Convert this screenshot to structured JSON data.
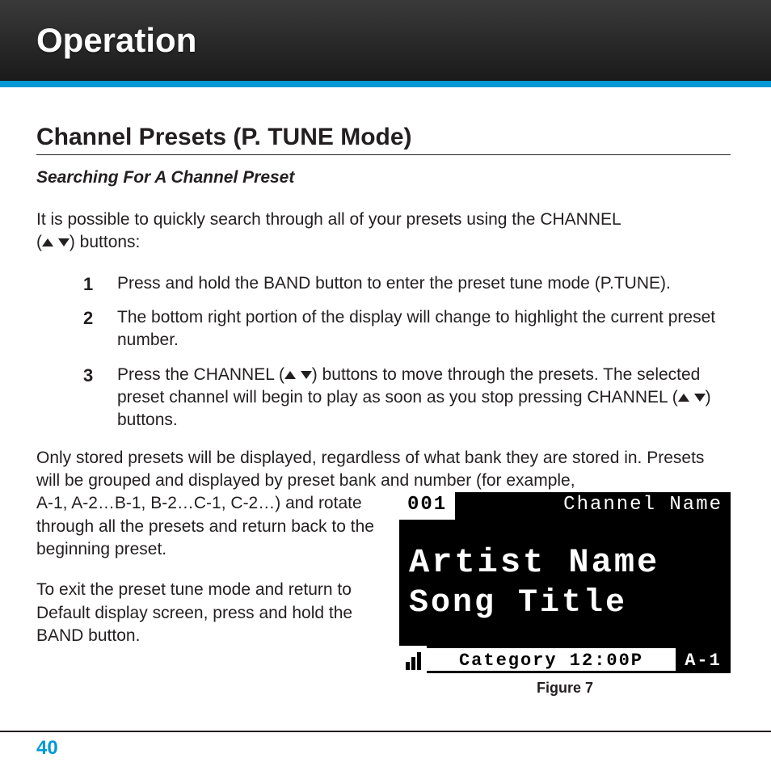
{
  "header": {
    "title": "Operation"
  },
  "section": {
    "title": "Channel Presets (P. TUNE Mode)",
    "subtitle": "Searching For A Channel Preset"
  },
  "intro": {
    "line1": "It is possible to quickly search through all of your presets using the CHANNEL",
    "line2_prefix": "(",
    "line2_suffix": ") buttons:"
  },
  "steps": [
    {
      "num": "1",
      "text": "Press and hold the BAND button to enter the preset tune mode (P.TUNE)."
    },
    {
      "num": "2",
      "text": "The bottom right portion of the display will change to highlight the current preset number."
    },
    {
      "num": "3",
      "t1": "Press the CHANNEL (",
      "t2": ") buttons to move through the presets. The selected preset channel will begin to play as soon as you stop pressing CHANNEL (",
      "t3": ") buttons."
    }
  ],
  "body": {
    "p1": "Only stored presets will be displayed, regardless of what bank they are stored in. Presets will be grouped and displayed by preset bank and number (for example,",
    "p1b": "A-1, A-2…B-1, B-2…C-1, C-2…) and rotate through all the presets and return back to the beginning preset.",
    "p2": "To exit the preset tune mode and return to Default display screen, press and hold the BAND button."
  },
  "lcd": {
    "channel_number": "001",
    "channel_name": "Channel Name",
    "artist": "Artist Name",
    "song": "Song Title",
    "category": "Category",
    "time": "12:00P",
    "preset": "A-1"
  },
  "figure_caption": "Figure 7",
  "page_number": "40"
}
